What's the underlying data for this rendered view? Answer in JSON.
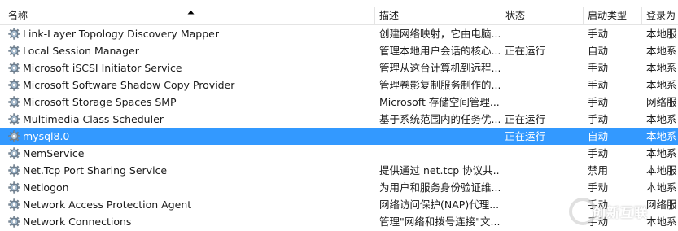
{
  "columns": {
    "name": "名称",
    "description": "描述",
    "status": "状态",
    "startup_type": "启动类型",
    "logon_as": "登录为"
  },
  "services": [
    {
      "name": "Link-Layer Topology Discovery Mapper",
      "description": "创建网络映射，它由电脑...",
      "status": "",
      "startup_type": "手动",
      "logon_as": "本地服"
    },
    {
      "name": "Local Session Manager",
      "description": "管理本地用户会话的核心...",
      "status": "正在运行",
      "startup_type": "自动",
      "logon_as": "本地系"
    },
    {
      "name": "Microsoft iSCSI Initiator Service",
      "description": "管理从这台计算机到远程...",
      "status": "",
      "startup_type": "手动",
      "logon_as": "本地系"
    },
    {
      "name": "Microsoft Software Shadow Copy Provider",
      "description": "管理卷影复制服务制作的...",
      "status": "",
      "startup_type": "手动",
      "logon_as": "本地系"
    },
    {
      "name": "Microsoft Storage Spaces SMP",
      "description": "Microsoft 存储空间管理...",
      "status": "",
      "startup_type": "手动",
      "logon_as": "网络服"
    },
    {
      "name": "Multimedia Class Scheduler",
      "description": "基于系统范围内的任务优...",
      "status": "正在运行",
      "startup_type": "手动",
      "logon_as": "本地系"
    },
    {
      "name": "mysql8.0",
      "description": "",
      "status": "正在运行",
      "startup_type": "自动",
      "logon_as": "本地系",
      "selected": true
    },
    {
      "name": "NemService",
      "description": "",
      "status": "",
      "startup_type": "手动",
      "logon_as": "本地系"
    },
    {
      "name": "Net.Tcp Port Sharing Service",
      "description": "提供通过 net.tcp 协议共...",
      "status": "",
      "startup_type": "禁用",
      "logon_as": "本地服"
    },
    {
      "name": "Netlogon",
      "description": "为用户和服务身份验证维...",
      "status": "",
      "startup_type": "手动",
      "logon_as": "本地系"
    },
    {
      "name": "Network Access Protection Agent",
      "description": "网络访问保护(NAP)代理...",
      "status": "",
      "startup_type": "手动",
      "logon_as": "网络服"
    },
    {
      "name": "Network Connections",
      "description": "管理\"网络和拨号连接\"文...",
      "status": "",
      "startup_type": "手动",
      "logon_as": "本地系"
    }
  ],
  "watermark": "创新互联",
  "colors": {
    "selection": "#3399ff",
    "grid_line": "#e4e4e4"
  },
  "icons": {
    "row_icon": "service-gear-icon",
    "sort_indicator": "sort-ascending-icon"
  }
}
